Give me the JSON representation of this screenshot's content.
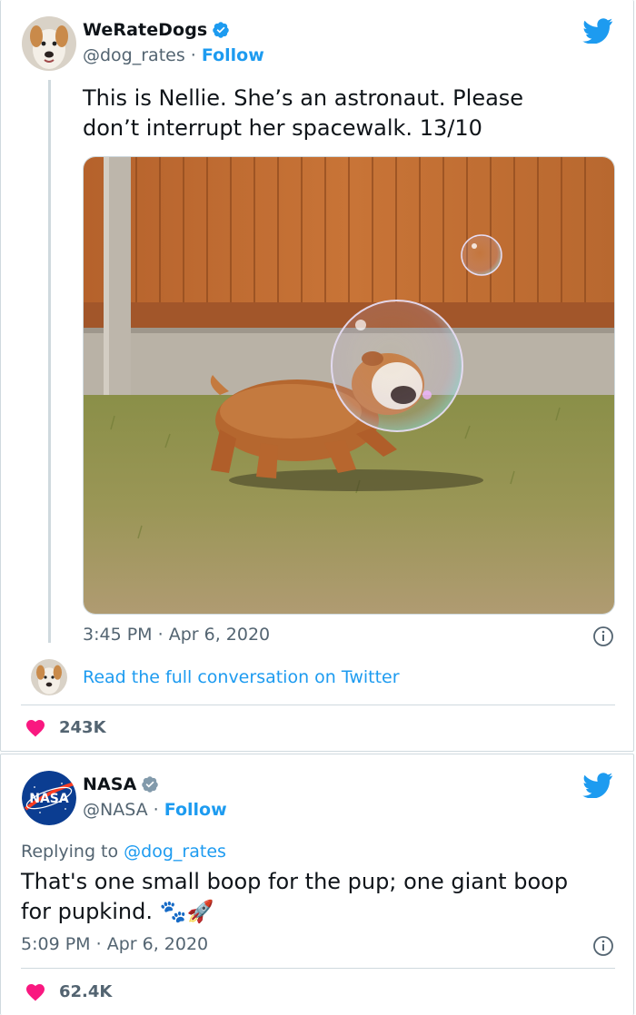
{
  "tweet1": {
    "name": "WeRateDogs",
    "handle": "@dog_rates",
    "separator": "·",
    "follow": "Follow",
    "text": "This is Nellie. She’s an astronaut. Please don’t interrupt her spacewalk. 13/10",
    "time": "3:45 PM",
    "date": "Apr 6, 2020",
    "conversation_link": "Read the full conversation on Twitter",
    "likes": "243K"
  },
  "tweet2": {
    "name": "NASA",
    "handle": "@NASA",
    "separator": "·",
    "follow": "Follow",
    "replying_prefix": "Replying to",
    "replying_handle": "@dog_rates",
    "text_line1": "That's one small boop for the pup; one giant boop",
    "text_line2": "for pupkind.",
    "emojis": "🐾🚀",
    "time": "5:09 PM",
    "date": "Apr 6, 2020",
    "likes": "62.4K"
  },
  "nasa_logo_text": "NASA",
  "colors": {
    "twitter_blue": "#1d9bf0",
    "like_red": "#f91880",
    "muted_text": "#536471",
    "border": "#cfd9de",
    "nasa_blue": "#0b3d91",
    "nasa_red": "#fc3d21"
  }
}
